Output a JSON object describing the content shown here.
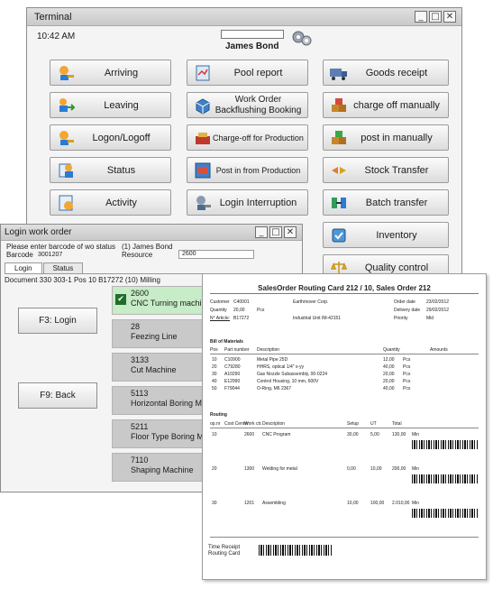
{
  "terminal": {
    "title": "Terminal",
    "time": "10:42 AM",
    "user": "James Bond",
    "window_buttons": [
      "_",
      "□",
      "✕"
    ],
    "buttons": [
      {
        "label": "Arriving",
        "icon": "key-person-icon"
      },
      {
        "label": "Pool report",
        "icon": "report-icon"
      },
      {
        "label": "Goods receipt",
        "icon": "truck-icon"
      },
      {
        "label": "Leaving",
        "icon": "person-exit-icon"
      },
      {
        "label": "Work Order Backflushing Booking",
        "icon": "box-icon"
      },
      {
        "label": "charge off manually",
        "icon": "boxes-icon"
      },
      {
        "label": "Logon/Logoff",
        "icon": "key-person-icon"
      },
      {
        "label": "Charge-off for Production",
        "icon": "production-icon"
      },
      {
        "label": "post in manually",
        "icon": "boxes-green-icon"
      },
      {
        "label": "Status",
        "icon": "status-icon"
      },
      {
        "label": "Post in from Production",
        "icon": "production-in-icon"
      },
      {
        "label": "Stock Transfer",
        "icon": "transfer-icon"
      },
      {
        "label": "Activity",
        "icon": "activity-icon"
      },
      {
        "label": "Login Interruption",
        "icon": "interruption-icon"
      },
      {
        "label": "Batch transfer",
        "icon": "batch-icon"
      },
      {
        "label": "Inventory",
        "icon": "inventory-icon"
      },
      {
        "label": "Quality control",
        "icon": "scale-icon"
      }
    ]
  },
  "login": {
    "title": "Login work order",
    "prompt": "Please enter barcode of wo status",
    "barcode_label": "Barcode",
    "barcode_value": "3001207",
    "user": "(1) James Bond",
    "resource_label": "Resource",
    "resource_value": "2600",
    "tabs": [
      "Login",
      "Status"
    ],
    "document_line": "Document 330 303-1 Pos 10 B17272 (10) Milling",
    "f3": "F3: Login",
    "f9": "F9: Back",
    "work_orders": [
      {
        "num": "2600",
        "name": "CNC Turning machining",
        "selected": true
      },
      {
        "num": "28",
        "name": "Feezing Line",
        "selected": false
      },
      {
        "num": "3133",
        "name": "Cut Machine",
        "selected": false
      },
      {
        "num": "5113",
        "name": "Horizontal  Boring Machine",
        "selected": false
      },
      {
        "num": "5211",
        "name": "Floor Type Boring Machine",
        "selected": false
      },
      {
        "num": "7110",
        "name": "Shaping Machine",
        "selected": false
      }
    ]
  },
  "routing_card": {
    "title": "SalesOrder     Routing Card 212 / 10,  Sales Order 212",
    "customer_label": "Customer",
    "customer_value": "C40001",
    "customer_name": "Earthmover Corp.",
    "order_date_label": "Order date",
    "order_date_value": "23/02/2012",
    "quantity_label": "Quantity",
    "quantity_value": "20,00",
    "unit": "Pcs",
    "delivery_date_label": "Delivery date",
    "delivery_date_value": "29/02/2012",
    "article_label": "N° Article:",
    "article_value": "B17272",
    "article_desc": "Industrial Unit IM-42151",
    "priority_label": "Priority",
    "priority_value": "Mid",
    "bom_title": "Bill of Materials",
    "bom_headers": [
      "Pos",
      "Part number",
      "Description",
      "Quantity",
      "Amounts"
    ],
    "bom_rows": [
      [
        "10",
        "C10900",
        "Metal Pipe 25D",
        "12,00",
        "Pcs"
      ],
      [
        "20",
        "C79280",
        "HHRS, optical 1/4\" x-yy",
        "40,00",
        "Pcs"
      ],
      [
        "30",
        "A10290",
        "Gas Nozzle Subassembly, 00-0224",
        "20,00",
        "Pcs"
      ],
      [
        "40",
        "E12990",
        "Control Housing, 10 mm, 600V",
        "20,00",
        "Pcs"
      ],
      [
        "50",
        "F79044",
        "O-Ring, M6 2367",
        "40,00",
        "Pcs"
      ]
    ],
    "routing_title": "Routing",
    "routing_headers": [
      "op.nr",
      "Cost Center",
      "Work ctr.",
      "Description",
      "Setup",
      "UT",
      "Total"
    ],
    "routing_rows": [
      [
        "10",
        "2600",
        "CNC Program",
        "30,00",
        "5,00",
        "130,00",
        "Min"
      ],
      [
        "20",
        "1300",
        "Welding for metal",
        "0,00",
        "10,00",
        "200,00",
        "Min"
      ],
      [
        "30",
        "1201",
        "Assembling",
        "10,00",
        "100,00",
        "2.010,00",
        "Min"
      ]
    ],
    "footer_line1": "Time Receipt",
    "footer_line2": "Routing Card"
  }
}
